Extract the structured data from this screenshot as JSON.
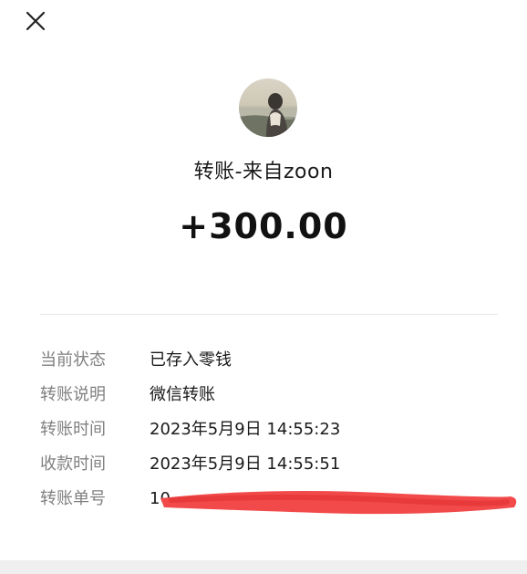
{
  "header": {
    "close_icon": "close-icon"
  },
  "transfer": {
    "title": "转账-来自zoon",
    "amount": "+300.00"
  },
  "details": {
    "rows": [
      {
        "label": "当前状态",
        "value": "已存入零钱"
      },
      {
        "label": "转账说明",
        "value": "微信转账"
      },
      {
        "label": "转账时间",
        "value": "2023年5月9日 14:55:23"
      },
      {
        "label": "收款时间",
        "value": "2023年5月9日 14:55:51"
      },
      {
        "label": "转账单号",
        "value": "10"
      }
    ]
  },
  "colors": {
    "redaction": "#f24a4a",
    "label": "#808080",
    "divider": "#e6e6e6"
  }
}
